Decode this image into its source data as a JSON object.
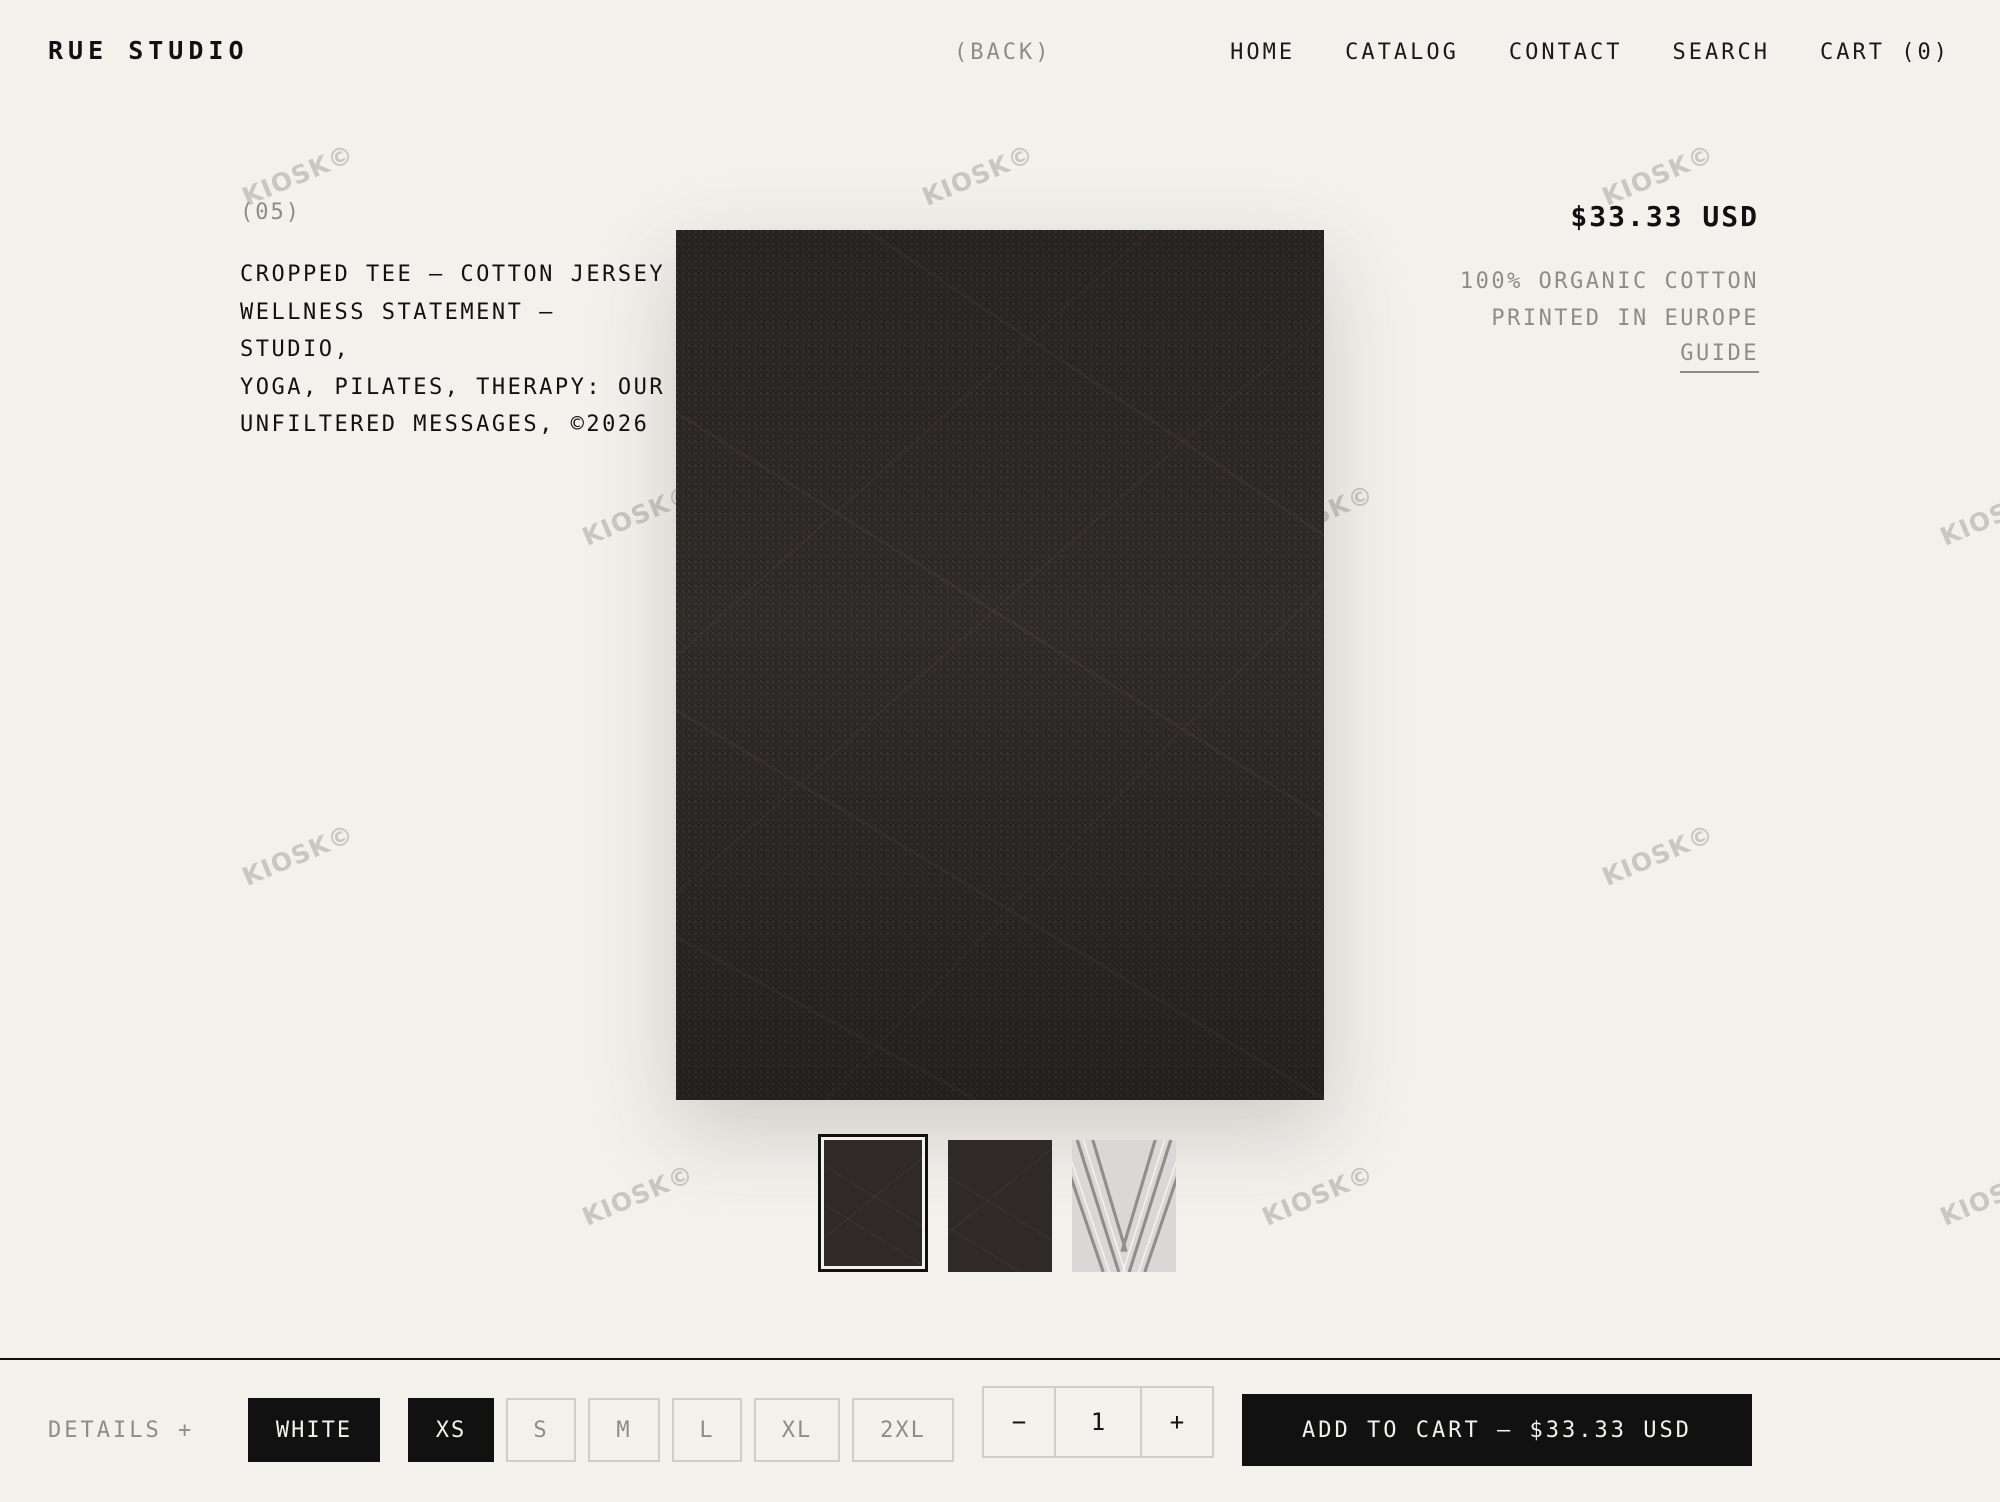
{
  "brand": {
    "name": "RUE STUDIO"
  },
  "header": {
    "back_label": "(BACK)",
    "nav": [
      {
        "label": "HOME"
      },
      {
        "label": "CATALOG"
      },
      {
        "label": "CONTACT"
      },
      {
        "label": "SEARCH"
      },
      {
        "label": "CART (0)"
      }
    ]
  },
  "watermark": {
    "text": "KIOSK©"
  },
  "product": {
    "index": "(05)",
    "title_lines": [
      "CROPPED TEE — COTTON JERSEY",
      "WELLNESS STATEMENT – STUDIO,",
      "YOGA, PILATES, THERAPY: OUR",
      "UNFILTERED MESSAGES, ©2026"
    ],
    "price": "$33.33 USD",
    "specs": [
      "100% ORGANIC COTTON",
      "PRINTED IN EUROPE"
    ],
    "guide_label": "GUIDE",
    "images": {
      "main": "dark-linen-fabric",
      "thumbnails": [
        {
          "name": "dark-linen-fabric",
          "active": true
        },
        {
          "name": "dark-linen-fabric",
          "active": false
        },
        {
          "name": "white-twisted-cord",
          "active": false
        }
      ]
    }
  },
  "purchase_bar": {
    "details_label": "DETAILS +",
    "color": {
      "selected": "WHITE"
    },
    "sizes": [
      {
        "label": "XS",
        "selected": true
      },
      {
        "label": "S",
        "selected": false
      },
      {
        "label": "M",
        "selected": false
      },
      {
        "label": "L",
        "selected": false
      },
      {
        "label": "XL",
        "selected": false
      },
      {
        "label": "2XL",
        "selected": false
      }
    ],
    "quantity": {
      "minus": "−",
      "value": "1",
      "plus": "+"
    },
    "add_to_cart_label": "ADD TO CART — $33.33 USD"
  },
  "colors": {
    "background": "#f2f1ec",
    "ink": "#111111",
    "muted": "#8e8c86",
    "border": "#cfcdc7",
    "fabric": "#2f2a27"
  }
}
